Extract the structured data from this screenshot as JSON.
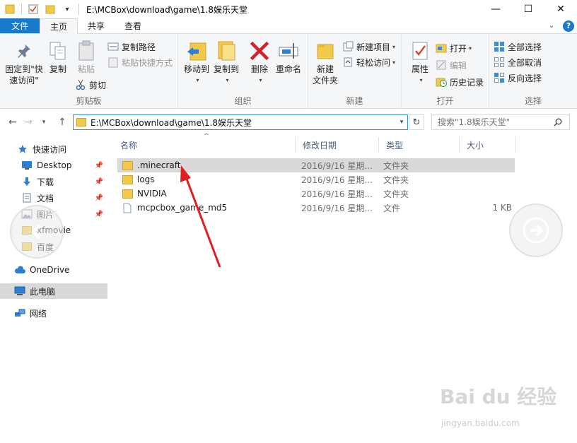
{
  "window": {
    "title": "E:\\MCBox\\download\\game\\1.8娱乐天堂",
    "minimize": "—",
    "maximize": "☐",
    "close": "✕"
  },
  "tabs": [
    {
      "label": "文件"
    },
    {
      "label": "主页"
    },
    {
      "label": "共享"
    },
    {
      "label": "查看"
    }
  ],
  "ribbon": {
    "clipboard": {
      "label": "剪贴板",
      "pin_line1": "固定到\"快",
      "pin_line2": "速访问\"",
      "copy": "复制",
      "paste": "粘贴",
      "copy_path": "复制路径",
      "paste_shortcut": "粘贴快捷方式",
      "cut": "剪切"
    },
    "organize": {
      "label": "组织",
      "move_to": "移动到",
      "copy_to": "复制到",
      "delete": "删除",
      "rename": "重命名"
    },
    "new": {
      "label": "新建",
      "new_folder_line1": "新建",
      "new_folder_line2": "文件夹",
      "new_item": "新建项目",
      "easy_access": "轻松访问"
    },
    "open": {
      "label": "打开",
      "properties": "属性",
      "open": "打开",
      "edit": "编辑",
      "history": "历史记录"
    },
    "select": {
      "label": "选择",
      "select_all": "全部选择",
      "select_none": "全部取消",
      "invert": "反向选择"
    }
  },
  "address": {
    "path": "E:\\MCBox\\download\\game\\1.8娱乐天堂",
    "search_placeholder": "搜索\"1.8娱乐天堂\""
  },
  "navpane": {
    "quick_access": "快速访问",
    "items": [
      {
        "label": "Desktop",
        "pinned": true
      },
      {
        "label": "下载",
        "pinned": true
      },
      {
        "label": "文档",
        "pinned": true
      },
      {
        "label": "图片",
        "pinned": true
      },
      {
        "label": "xfmovie",
        "pinned": false
      },
      {
        "label": "百度",
        "pinned": false
      }
    ],
    "onedrive": "OneDrive",
    "this_pc": "此电脑",
    "network": "网络"
  },
  "columns": {
    "name": "名称",
    "date": "修改日期",
    "type": "类型",
    "size": "大小"
  },
  "files": [
    {
      "name": ".minecraft",
      "date": "2016/9/16 星期...",
      "type": "文件夹",
      "size": "",
      "kind": "folder"
    },
    {
      "name": "logs",
      "date": "2016/9/16 星期...",
      "type": "文件夹",
      "size": "",
      "kind": "folder"
    },
    {
      "name": "NVIDIA",
      "date": "2016/9/16 星期...",
      "type": "文件夹",
      "size": "",
      "kind": "folder"
    },
    {
      "name": "mcpcbox_game_md5",
      "date": "2016/9/16 星期...",
      "type": "文件",
      "size": "1 KB",
      "kind": "file"
    }
  ],
  "watermark": {
    "text": "Bai du 经验",
    "sub": "jingyan.baidu.com"
  },
  "colors": {
    "accent": "#1979ca",
    "folder": "#f3c94a",
    "arrow": "#e02020"
  }
}
